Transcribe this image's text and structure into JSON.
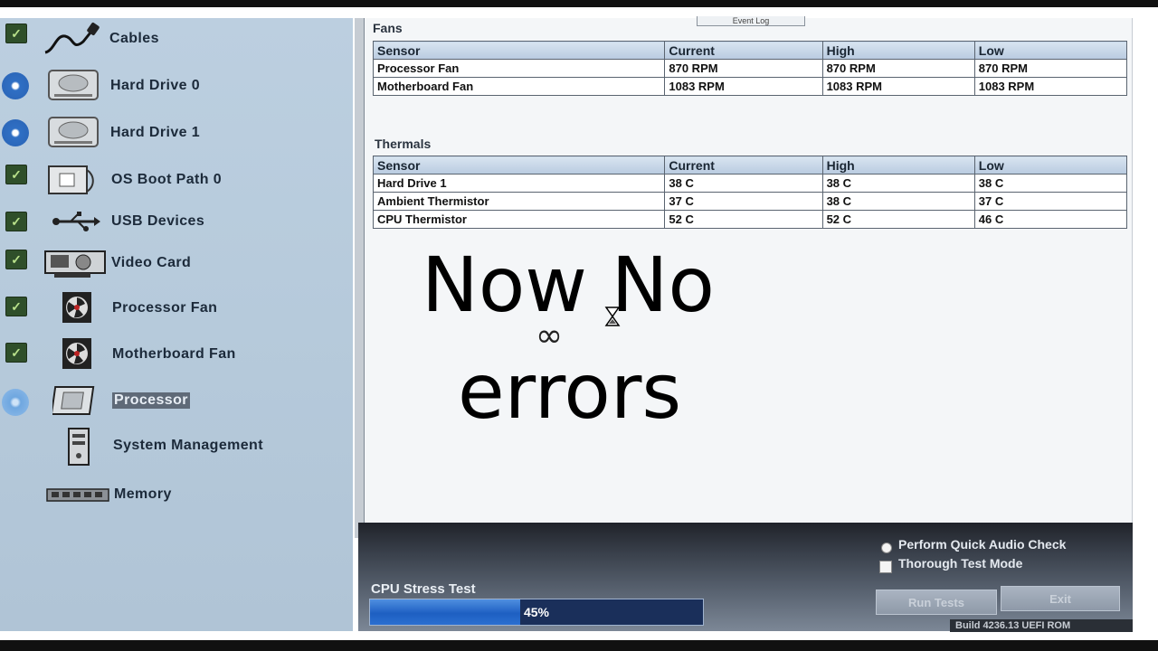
{
  "sidebar": {
    "items": [
      {
        "label": "Cables",
        "status": "check",
        "icon": "cable-icon"
      },
      {
        "label": "Hard Drive 0",
        "status": "running",
        "icon": "hard-drive-icon"
      },
      {
        "label": "Hard Drive 1",
        "status": "running",
        "icon": "hard-drive-icon"
      },
      {
        "label": "OS Boot Path 0",
        "status": "check",
        "icon": "boot-path-icon"
      },
      {
        "label": "USB Devices",
        "status": "check",
        "icon": "usb-icon"
      },
      {
        "label": "Video Card",
        "status": "check",
        "icon": "video-card-icon"
      },
      {
        "label": "Processor Fan",
        "status": "check",
        "icon": "fan-icon"
      },
      {
        "label": "Motherboard Fan",
        "status": "check",
        "icon": "fan-icon"
      },
      {
        "label": "Processor",
        "status": "running",
        "icon": "processor-icon",
        "selected": true
      },
      {
        "label": "System Management",
        "status": "none",
        "icon": "system-management-icon"
      },
      {
        "label": "Memory",
        "status": "none",
        "icon": "memory-icon"
      }
    ]
  },
  "tabs": {
    "event_log": "Event Log"
  },
  "fans": {
    "title": "Fans",
    "headers": [
      "Sensor",
      "Current",
      "High",
      "Low"
    ],
    "rows": [
      [
        "Processor Fan",
        "870 RPM",
        "870 RPM",
        "870 RPM"
      ],
      [
        "Motherboard Fan",
        "1083 RPM",
        "1083 RPM",
        "1083 RPM"
      ]
    ]
  },
  "thermals": {
    "title": "Thermals",
    "headers": [
      "Sensor",
      "Current",
      "High",
      "Low"
    ],
    "rows": [
      [
        "Hard Drive 1",
        "38 C",
        "38 C",
        "38 C"
      ],
      [
        "Ambient Thermistor",
        "37 C",
        "38 C",
        "37 C"
      ],
      [
        "CPU Thermistor",
        "52 C",
        "52 C",
        "46 C"
      ]
    ]
  },
  "overlay": {
    "line1": "Now No",
    "symbol": "∞",
    "line2": "errors"
  },
  "bottom": {
    "stress_label": "CPU Stress Test",
    "progress_value": 45,
    "progress_text": "45%",
    "quick_audio_label": "Perform Quick Audio Check",
    "thorough_label": "Thorough Test Mode",
    "run_tests_label": "Run Tests",
    "exit_label": "Exit",
    "build_text": "Build  4236.13 UEFI ROM"
  },
  "colors": {
    "sidebar_bg": "#b6cadb",
    "check_green": "#2f4f2a",
    "running_blue": "#2a63b4",
    "table_header": "#c9d8e8",
    "progress_blue": "#1e5fc2"
  }
}
